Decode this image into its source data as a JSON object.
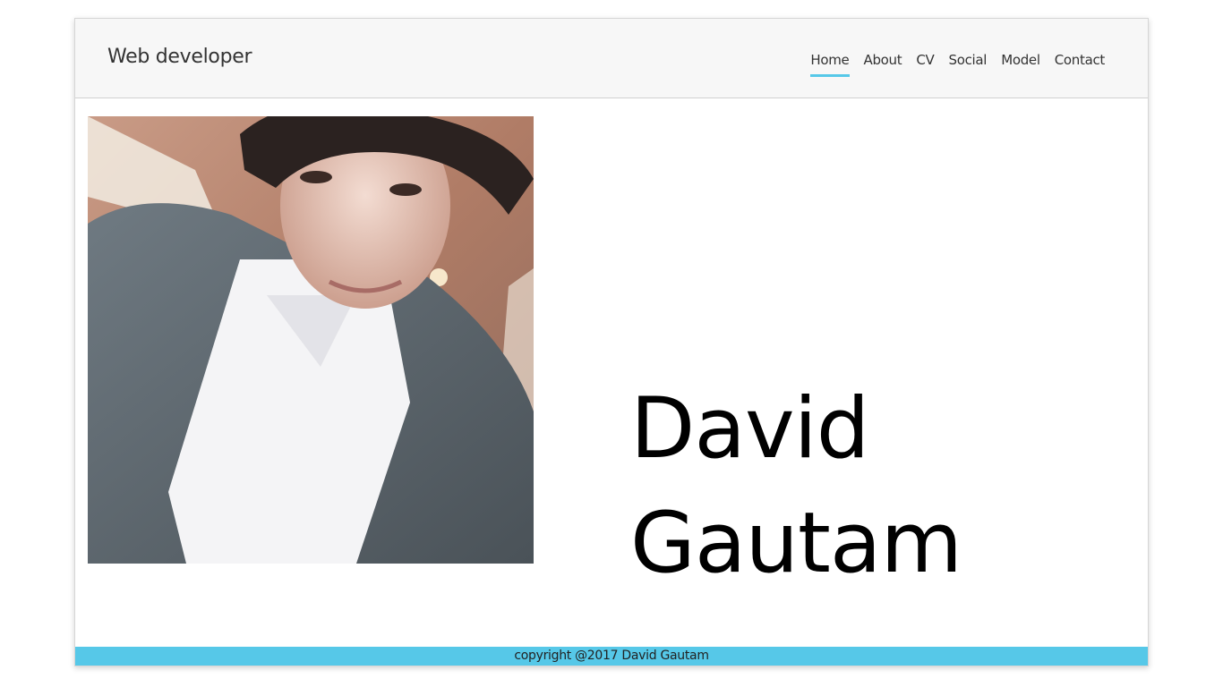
{
  "header": {
    "brand": "Web developer",
    "nav": [
      {
        "label": "Home",
        "active": true
      },
      {
        "label": "About",
        "active": false
      },
      {
        "label": "CV",
        "active": false
      },
      {
        "label": "Social",
        "active": false
      },
      {
        "label": "Model",
        "active": false
      },
      {
        "label": "Contact",
        "active": false
      }
    ]
  },
  "main": {
    "first_name": "David",
    "last_name": "Gautam"
  },
  "footer": {
    "copyright": "copyright @2017 David Gautam"
  },
  "colors": {
    "accent": "#56c8e8",
    "navbar_bg": "#f7f7f7",
    "text": "#333333"
  }
}
